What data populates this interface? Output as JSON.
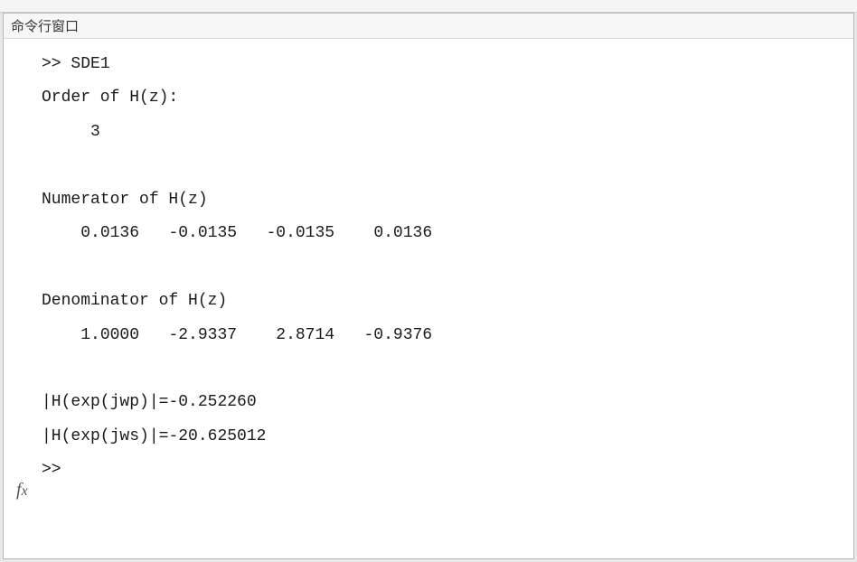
{
  "window": {
    "title": "命令行窗口"
  },
  "console": {
    "prompt": ">>",
    "command": "SDE1",
    "order_label": "Order of H(z):",
    "order_value": "3",
    "numerator_label": "Numerator of H(z)",
    "numerator": [
      "0.0136",
      "-0.0135",
      "-0.0135",
      "0.0136"
    ],
    "denominator_label": "Denominator of H(z)",
    "denominator": [
      "1.0000",
      "-2.9337",
      "2.8714",
      "-0.9376"
    ],
    "hjwp_label": "|H(exp(jwp)|=",
    "hjwp_value": "-0.252260",
    "hjws_label": "|H(exp(jws)|=",
    "hjws_value": "-20.625012"
  },
  "icons": {
    "fx": "fx"
  }
}
